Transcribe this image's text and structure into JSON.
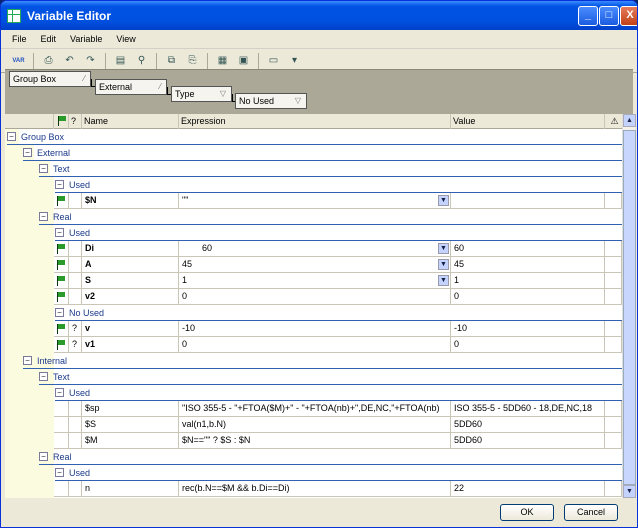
{
  "window": {
    "title": "Variable Editor",
    "minimize": "_",
    "maximize": "□",
    "close": "X"
  },
  "menu": [
    "File",
    "Edit",
    "Variable",
    "View"
  ],
  "toolbar": {
    "items": [
      {
        "icon": "var-icon",
        "glyph": "VAR"
      },
      {
        "icon": "print-icon",
        "glyph": "⎙"
      },
      {
        "icon": "undo-icon",
        "glyph": "↶"
      },
      {
        "icon": "redo-icon",
        "glyph": "↷"
      },
      {
        "icon": "properties-icon",
        "glyph": "▤"
      },
      {
        "icon": "find-icon",
        "glyph": "⚲"
      },
      {
        "icon": "copy-icon",
        "glyph": "⧉"
      },
      {
        "icon": "paste-icon",
        "glyph": "⎘"
      },
      {
        "icon": "grid-icon",
        "glyph": "▦"
      },
      {
        "icon": "table-icon",
        "glyph": "▣"
      },
      {
        "icon": "window-icon",
        "glyph": "▭"
      },
      {
        "icon": "dropdown-icon",
        "glyph": "▾"
      }
    ]
  },
  "grouping": {
    "chips": [
      "Group Box",
      "External",
      "Type",
      "No Used"
    ]
  },
  "columns": {
    "flag": "",
    "q": "?",
    "name": "Name",
    "expression": "Expression",
    "value": "Value",
    "warn": "⚠"
  },
  "rows": [
    {
      "kind": "group",
      "level": 0,
      "label": "Group Box"
    },
    {
      "kind": "group",
      "level": 1,
      "label": "External"
    },
    {
      "kind": "group",
      "level": 2,
      "label": "Text"
    },
    {
      "kind": "group",
      "level": 3,
      "label": "Used"
    },
    {
      "kind": "data",
      "flag": true,
      "q": "",
      "name": "$N",
      "expr": "\"\"",
      "value": "",
      "bold": true,
      "dd": true
    },
    {
      "kind": "group",
      "level": 2,
      "label": "Real"
    },
    {
      "kind": "group",
      "level": 3,
      "label": "Used"
    },
    {
      "kind": "data",
      "flag": true,
      "q": "",
      "name": "Di",
      "expr": "60",
      "value": "60",
      "bold": true,
      "dd": true,
      "indent": true
    },
    {
      "kind": "data",
      "flag": true,
      "q": "",
      "name": "A",
      "expr": "45",
      "value": "45",
      "bold": true,
      "dd": true
    },
    {
      "kind": "data",
      "flag": true,
      "q": "",
      "name": "S",
      "expr": "1",
      "value": "1",
      "bold": true,
      "dd": true
    },
    {
      "kind": "data",
      "flag": true,
      "q": "",
      "name": "v2",
      "expr": "0",
      "value": "0",
      "bold": true
    },
    {
      "kind": "group",
      "level": 3,
      "label": "No Used"
    },
    {
      "kind": "data",
      "flag": true,
      "q": "?",
      "name": "v",
      "expr": "-10",
      "value": "-10",
      "bold": true
    },
    {
      "kind": "data",
      "flag": true,
      "q": "?",
      "name": "v1",
      "expr": "0",
      "value": "0",
      "bold": true
    },
    {
      "kind": "group",
      "level": 1,
      "label": "Internal"
    },
    {
      "kind": "group",
      "level": 2,
      "label": "Text"
    },
    {
      "kind": "group",
      "level": 3,
      "label": "Used"
    },
    {
      "kind": "data",
      "flag": false,
      "q": "",
      "name": "$sp",
      "expr": "\"ISO 355-5 - \"+FTOA($M)+\" - \"+FTOA(nb)+\",DE,NC,\"+FTOA(nb)",
      "value": "ISO 355-5 - 5DD60 - 18,DE,NC,18"
    },
    {
      "kind": "data",
      "flag": false,
      "q": "",
      "name": "$S",
      "expr": "val(n1,b.N)",
      "value": "5DD60"
    },
    {
      "kind": "data",
      "flag": false,
      "q": "",
      "name": "$M",
      "expr": "$N==\"\" ? $S : $N",
      "value": "5DD60"
    },
    {
      "kind": "group",
      "level": 2,
      "label": "Real"
    },
    {
      "kind": "group",
      "level": 3,
      "label": "Used"
    },
    {
      "kind": "data",
      "flag": false,
      "q": "",
      "name": "n",
      "expr": "rec(b.N==$M && b.Di==Di)",
      "value": "22"
    }
  ],
  "buttons": {
    "ok": "OK",
    "cancel": "Cancel"
  },
  "colors": {
    "title": "#0054e3",
    "group_line": "#3060b0",
    "flag": "#2a9a2a",
    "yellow": "#fbfbe0"
  }
}
